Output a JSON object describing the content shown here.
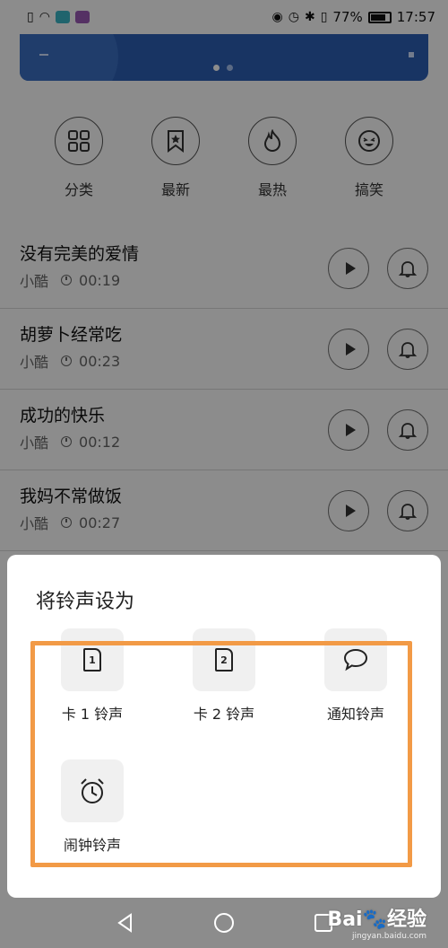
{
  "status_bar": {
    "battery": "77%",
    "time": "17:57"
  },
  "categories": [
    {
      "label": "分类",
      "icon": "grid-icon"
    },
    {
      "label": "最新",
      "icon": "bookmark-star-icon"
    },
    {
      "label": "最热",
      "icon": "flame-icon"
    },
    {
      "label": "搞笑",
      "icon": "laughing-face-icon"
    }
  ],
  "songs": [
    {
      "title": "没有完美的爱情",
      "artist": "小酷",
      "duration": "00:19"
    },
    {
      "title": "胡萝卜经常吃",
      "artist": "小酷",
      "duration": "00:23"
    },
    {
      "title": "成功的快乐",
      "artist": "小酷",
      "duration": "00:12"
    },
    {
      "title": "我妈不常做饭",
      "artist": "小酷",
      "duration": "00:27"
    }
  ],
  "dialog": {
    "title": "将铃声设为",
    "options": [
      {
        "label": "卡 1 铃声",
        "sim": "1",
        "icon": "sim1-icon"
      },
      {
        "label": "卡 2 铃声",
        "sim": "2",
        "icon": "sim2-icon"
      },
      {
        "label": "通知铃声",
        "icon": "chat-bubble-icon"
      },
      {
        "label": "闹钟铃声",
        "icon": "alarm-clock-icon"
      }
    ],
    "highlight_color": "#f29a46"
  },
  "watermark": {
    "brand": "Bai",
    "suffix": "经验",
    "url": "jingyan.baidu.com"
  }
}
